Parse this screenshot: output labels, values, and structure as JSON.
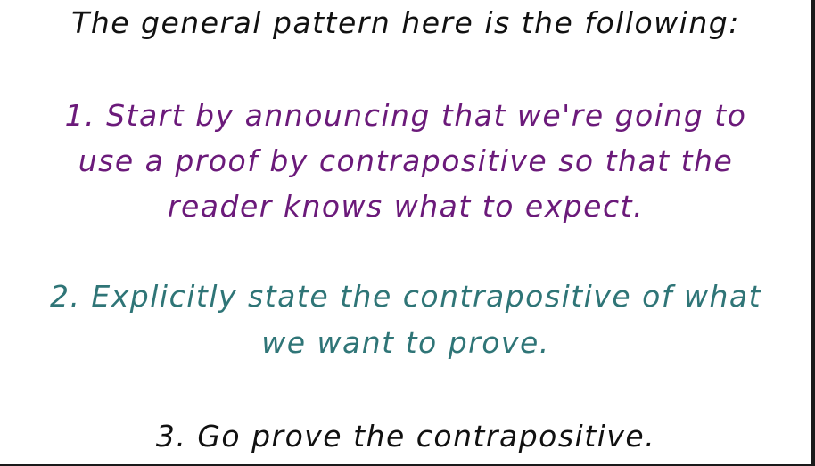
{
  "header": {
    "text": "The general pattern here is the following:"
  },
  "steps": [
    {
      "lines": [
        "1. Start by announcing that we're going to",
        "use a proof by contrapositive so that the",
        "reader knows what to expect."
      ],
      "color": "#6b1a7a"
    },
    {
      "lines": [
        "2. Explicitly state the contrapositive of what",
        "we want to prove."
      ],
      "color": "#2f7577"
    },
    {
      "lines": [
        "3. Go prove the contrapositive."
      ],
      "color": "#111111"
    }
  ]
}
